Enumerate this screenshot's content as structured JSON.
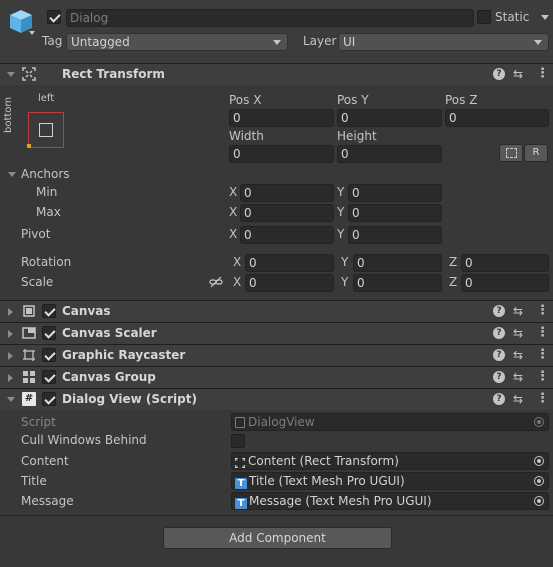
{
  "header": {
    "active": true,
    "name": "Dialog",
    "static_label": "Static",
    "static": false,
    "tag_label": "Tag",
    "tag_value": "Untagged",
    "layer_label": "Layer",
    "layer_value": "UI"
  },
  "rect_transform": {
    "title": "Rect Transform",
    "anchor_preset": {
      "h": "left",
      "v": "bottom"
    },
    "pos_x_label": "Pos X",
    "pos_x": "0",
    "pos_y_label": "Pos Y",
    "pos_y": "0",
    "pos_z_label": "Pos Z",
    "pos_z": "0",
    "width_label": "Width",
    "width": "0",
    "height_label": "Height",
    "height": "0",
    "r_button": "R",
    "anchors_label": "Anchors",
    "min_label": "Min",
    "min_x": "0",
    "min_y": "0",
    "max_label": "Max",
    "max_x": "0",
    "max_y": "0",
    "pivot_label": "Pivot",
    "pivot_x": "0",
    "pivot_y": "0",
    "rotation_label": "Rotation",
    "rot_x": "0",
    "rot_y": "0",
    "rot_z": "0",
    "scale_label": "Scale",
    "scale_x": "0",
    "scale_y": "0",
    "scale_z": "0",
    "axis_x": "X",
    "axis_y": "Y",
    "axis_z": "Z"
  },
  "components": [
    {
      "title": "Canvas",
      "enabled": true,
      "icon": "canvas-icon"
    },
    {
      "title": "Canvas Scaler",
      "enabled": true,
      "icon": "canvas-scaler-icon"
    },
    {
      "title": "Graphic Raycaster",
      "enabled": true,
      "icon": "raycaster-icon"
    },
    {
      "title": "Canvas Group",
      "enabled": true,
      "icon": "canvas-group-icon"
    }
  ],
  "dialog_view": {
    "title": "Dialog View (Script)",
    "enabled": true,
    "script_label": "Script",
    "script_value": "DialogView",
    "cull_label": "Cull Windows Behind",
    "cull_value": false,
    "content_label": "Content",
    "content_value": "Content (Rect Transform)",
    "title_label": "Title",
    "title_value": "Title (Text Mesh Pro UGUI)",
    "message_label": "Message",
    "message_value": "Message (Text Mesh Pro UGUI)"
  },
  "add_component": "Add Component",
  "icons": {
    "header_icon": "gameobject-cube-icon",
    "help": "?",
    "presets": "⇆",
    "more": "⋮"
  },
  "colors": {
    "background": "#383838",
    "field": "#2a2a2a",
    "cube": "#5cb4e8",
    "text_icon": "#4a90d9"
  }
}
